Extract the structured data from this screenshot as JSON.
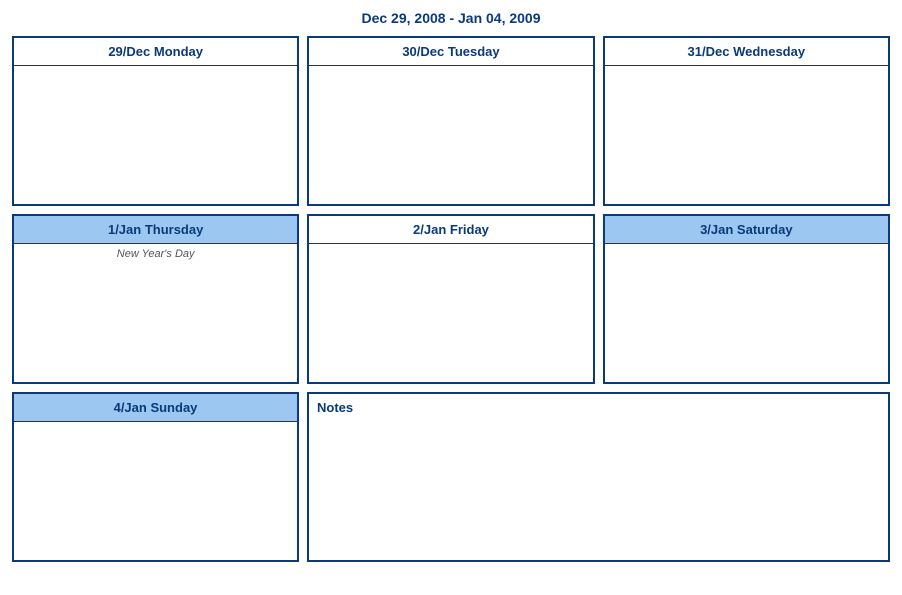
{
  "title": "Dec 29, 2008 - Jan 04, 2009",
  "days": [
    {
      "label": "29/Dec Monday",
      "weekend": false,
      "event": ""
    },
    {
      "label": "30/Dec Tuesday",
      "weekend": false,
      "event": ""
    },
    {
      "label": "31/Dec Wednesday",
      "weekend": false,
      "event": ""
    },
    {
      "label": "1/Jan Thursday",
      "weekend": true,
      "event": "New Year's Day"
    },
    {
      "label": "2/Jan Friday",
      "weekend": false,
      "event": ""
    },
    {
      "label": "3/Jan Saturday",
      "weekend": true,
      "event": ""
    },
    {
      "label": "4/Jan Sunday",
      "weekend": true,
      "event": ""
    }
  ],
  "notes_label": "Notes"
}
